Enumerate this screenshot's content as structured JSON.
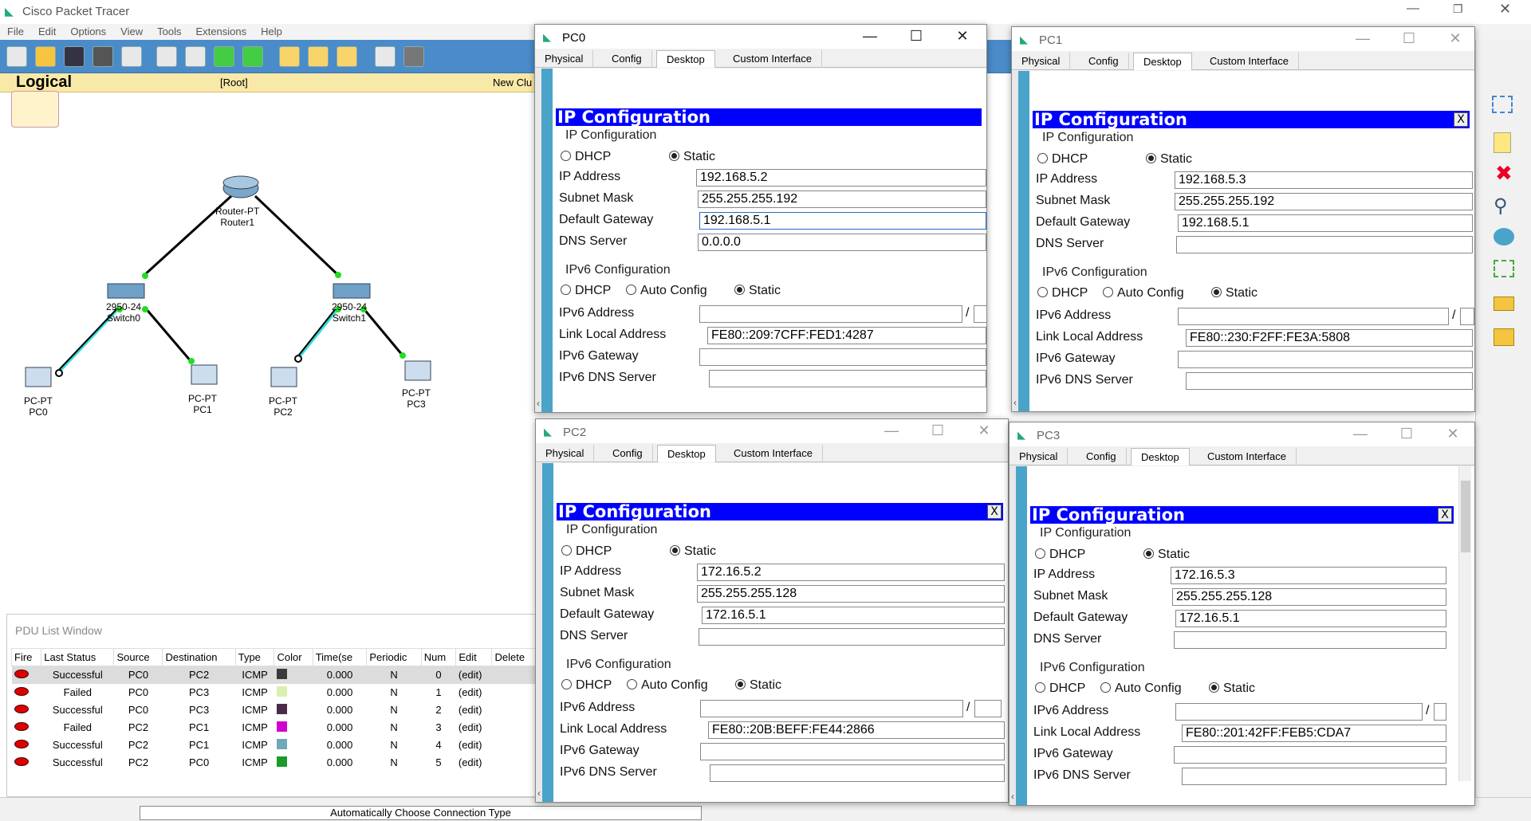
{
  "app": {
    "title": "Cisco Packet Tracer",
    "menu": [
      "File",
      "Edit",
      "Options",
      "View",
      "Tools",
      "Extensions",
      "Help"
    ],
    "logical_label": "Logical",
    "root_label": "[Root]",
    "new_cluster_label": "New Clu",
    "connection_type": "Automatically Choose Connection Type"
  },
  "topology": {
    "router": {
      "type": "Router-PT",
      "name": "Router1"
    },
    "switches": [
      {
        "type": "2950-24",
        "name": "Switch0"
      },
      {
        "type": "2950-24",
        "name": "Switch1"
      }
    ],
    "pcs": [
      {
        "type": "PC-PT",
        "name": "PC0"
      },
      {
        "type": "PC-PT",
        "name": "PC1"
      },
      {
        "type": "PC-PT",
        "name": "PC2"
      },
      {
        "type": "PC-PT",
        "name": "PC3"
      }
    ]
  },
  "pdu": {
    "title": "PDU List Window",
    "columns": [
      "Fire",
      "Last Status",
      "Source",
      "Destination",
      "Type",
      "Color",
      "Time(se",
      "Periodic",
      "Num",
      "Edit",
      "Delete"
    ],
    "rows": [
      {
        "status": "Successful",
        "src": "PC0",
        "dst": "PC2",
        "type": "ICMP",
        "color": "#3a3a3a",
        "time": "0.000",
        "periodic": "N",
        "num": "0",
        "edit": "(edit)"
      },
      {
        "status": "Failed",
        "src": "PC0",
        "dst": "PC3",
        "type": "ICMP",
        "color": "#d9f0b0",
        "time": "0.000",
        "periodic": "N",
        "num": "1",
        "edit": "(edit)"
      },
      {
        "status": "Successful",
        "src": "PC0",
        "dst": "PC3",
        "type": "ICMP",
        "color": "#4a2c4a",
        "time": "0.000",
        "periodic": "N",
        "num": "2",
        "edit": "(edit)"
      },
      {
        "status": "Failed",
        "src": "PC2",
        "dst": "PC1",
        "type": "ICMP",
        "color": "#d000d0",
        "time": "0.000",
        "periodic": "N",
        "num": "3",
        "edit": "(edit)"
      },
      {
        "status": "Successful",
        "src": "PC2",
        "dst": "PC1",
        "type": "ICMP",
        "color": "#6fa8b8",
        "time": "0.000",
        "periodic": "N",
        "num": "4",
        "edit": "(edit)"
      },
      {
        "status": "Successful",
        "src": "PC2",
        "dst": "PC0",
        "type": "ICMP",
        "color": "#1a9a2a",
        "time": "0.000",
        "periodic": "N",
        "num": "5",
        "edit": "(edit)"
      }
    ]
  },
  "tabs": [
    "Physical",
    "Config",
    "Desktop",
    "Custom Interface"
  ],
  "labels": {
    "ip_config_header": "IP Configuration",
    "ip_config_section": "IP Configuration",
    "dhcp": "DHCP",
    "static": "Static",
    "ip_address": "IP Address",
    "subnet_mask": "Subnet Mask",
    "default_gateway": "Default Gateway",
    "dns_server": "DNS Server",
    "ipv6_section": "IPv6 Configuration",
    "auto_config": "Auto Config",
    "ipv6_address": "IPv6 Address",
    "link_local": "Link Local Address",
    "ipv6_gateway": "IPv6 Gateway",
    "ipv6_dns": "IPv6 DNS Server",
    "close_x": "X"
  },
  "dialogs": [
    {
      "title": "PC0",
      "ip": "192.168.5.2",
      "mask": "255.255.255.192",
      "gateway": "192.168.5.1",
      "dns": "0.0.0.0",
      "link_local": "FE80::209:7CFF:FED1:4287"
    },
    {
      "title": "PC1",
      "ip": "192.168.5.3",
      "mask": "255.255.255.192",
      "gateway": "192.168.5.1",
      "dns": "",
      "link_local": "FE80::230:F2FF:FE3A:5808"
    },
    {
      "title": "PC2",
      "ip": "172.16.5.2",
      "mask": "255.255.255.128",
      "gateway": "172.16.5.1",
      "dns": "",
      "link_local": "FE80::20B:BEFF:FE44:2866"
    },
    {
      "title": "PC3",
      "ip": "172.16.5.3",
      "mask": "255.255.255.128",
      "gateway": "172.16.5.1",
      "dns": "",
      "link_local": "FE80::201:42FF:FEB5:CDA7"
    }
  ],
  "colors": {
    "toolbar": "#4a8bc9",
    "ip_header": "#0000ff",
    "logical_bar": "#f9e9a8",
    "link_green": "#22dd22",
    "link_cyan": "#33dddd"
  }
}
